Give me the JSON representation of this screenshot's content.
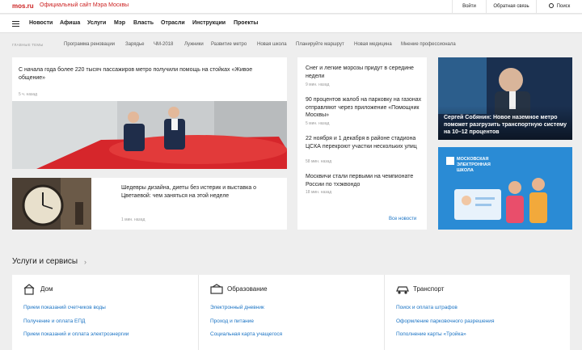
{
  "header": {
    "logo": "mos.ru",
    "site_title": "Официальный сайт Мэра Москвы",
    "login": "Войти",
    "feedback": "Обратная связь",
    "search": "Поиск"
  },
  "nav": [
    "Новости",
    "Афиша",
    "Услуги",
    "Мэр",
    "Власть",
    "Отрасли",
    "Инструкции",
    "Проекты"
  ],
  "topics": {
    "label": "ГЛАВНЫЕ ТЕМЫ",
    "items": [
      "Программа реновации",
      "Зарядье",
      "ЧМ-2018",
      "Лужники",
      "Развитие метро",
      "Новая школа",
      "Планируйте маршрут",
      "Новая медицина",
      "Мнение профессионала"
    ]
  },
  "feature": {
    "headline": "С начала года более 220 тысяч пассажиров метро получили помощь на стойках «Живое общение»",
    "time": "5 ч. назад"
  },
  "story2": {
    "headline": "Шедевры дизайна, диеты без истерик и выставка о Цветаевой: чем заняться на этой неделе",
    "time": "1 мин. назад"
  },
  "news": [
    {
      "headline": "Снег и легкие морозы придут в середине недели",
      "time": "9 мин. назад"
    },
    {
      "headline": "90 процентов жалоб на парковку на газонах отправляют через приложение «Помощник Москвы»",
      "time": "5 мин. назад"
    },
    {
      "headline": "22 ноября и 1 декабря в районе стадиона ЦСКА перекроют участки нескольких улиц",
      "time": "58 мин. назад"
    },
    {
      "headline": "Москвичи стали первыми на чемпионате России по тхэквондо",
      "time": "18 мин. назад"
    }
  ],
  "all_news": "Все новости",
  "promo_sobyanin": "Сергей Собянин: Новое наземное метро поможет разгрузить транспортную систему на 10–12 процентов",
  "promo_school": "МОСКОВСКАЯ ЭЛЕКТРОННАЯ ШКОЛА",
  "services": {
    "title": "Услуги и сервисы",
    "columns": [
      {
        "title": "Дом",
        "links": [
          "Прием показаний счетчиков воды",
          "Получение и оплата ЕПД",
          "Прием показаний и оплата электроэнергии"
        ]
      },
      {
        "title": "Образование",
        "links": [
          "Электронный дневник",
          "Проход и питание",
          "Социальная карта учащегося"
        ]
      },
      {
        "title": "Транспорт",
        "links": [
          "Поиск и оплата штрафов",
          "Оформление парковочного разрешения",
          "Пополнение карты «Тройка»"
        ]
      }
    ]
  },
  "colors": {
    "brand": "#cc2222",
    "link": "#1a73c4"
  }
}
